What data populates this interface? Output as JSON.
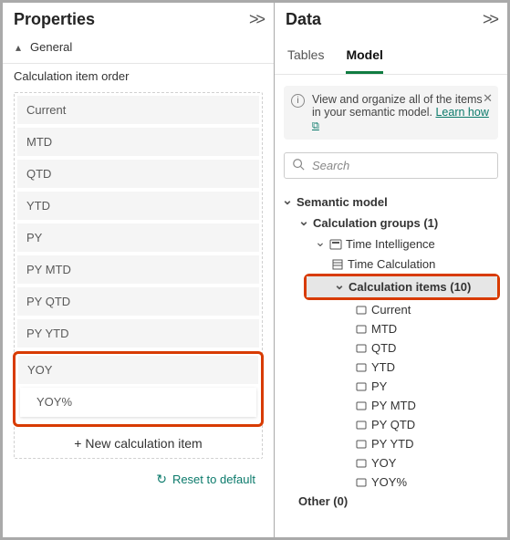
{
  "properties": {
    "title": "Properties",
    "general_label": "General",
    "order_label": "Calculation item order",
    "items": {
      "i0": "Current",
      "i1": "MTD",
      "i2": "QTD",
      "i3": "YTD",
      "i4": "PY",
      "i5": "PY MTD",
      "i6": "PY QTD",
      "i7": "PY YTD",
      "i8": "YOY",
      "i9": "YOY%"
    },
    "new_item_label": "+ New calculation item",
    "reset_label": "Reset to default"
  },
  "data": {
    "title": "Data",
    "tabs": {
      "tables": "Tables",
      "model": "Model"
    },
    "info": {
      "text": "View and organize all of the items in your semantic model. ",
      "link": "Learn how"
    },
    "search_placeholder": "Search",
    "tree": {
      "root": "Semantic model",
      "calc_groups": "Calculation groups (1)",
      "time_intel": "Time Intelligence",
      "time_calc": "Time Calculation",
      "calc_items": "Calculation items (10)",
      "items": {
        "c0": "Current",
        "c1": "MTD",
        "c2": "QTD",
        "c3": "YTD",
        "c4": "PY",
        "c5": "PY MTD",
        "c6": "PY QTD",
        "c7": "PY YTD",
        "c8": "YOY",
        "c9": "YOY%"
      },
      "other": "Other (0)"
    }
  }
}
